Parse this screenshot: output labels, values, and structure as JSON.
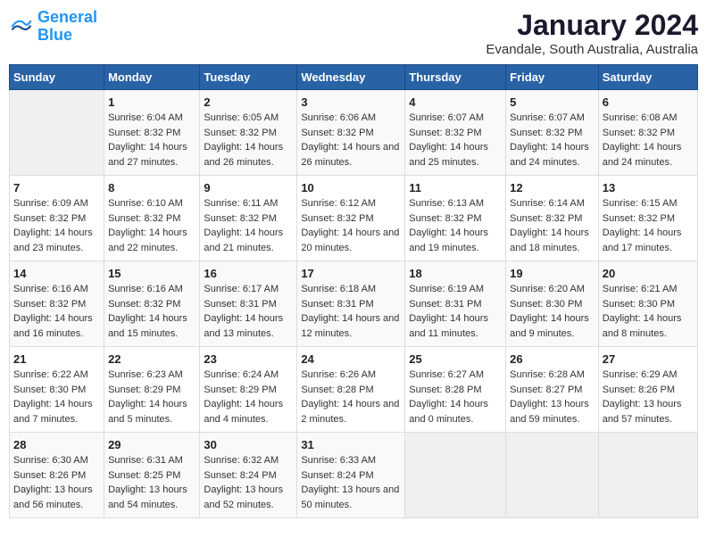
{
  "header": {
    "logo_line1": "General",
    "logo_line2": "Blue",
    "month": "January 2024",
    "location": "Evandale, South Australia, Australia"
  },
  "weekdays": [
    "Sunday",
    "Monday",
    "Tuesday",
    "Wednesday",
    "Thursday",
    "Friday",
    "Saturday"
  ],
  "weeks": [
    [
      {
        "day": "",
        "sunrise": "",
        "sunset": "",
        "daylight": ""
      },
      {
        "day": "1",
        "sunrise": "Sunrise: 6:04 AM",
        "sunset": "Sunset: 8:32 PM",
        "daylight": "Daylight: 14 hours and 27 minutes."
      },
      {
        "day": "2",
        "sunrise": "Sunrise: 6:05 AM",
        "sunset": "Sunset: 8:32 PM",
        "daylight": "Daylight: 14 hours and 26 minutes."
      },
      {
        "day": "3",
        "sunrise": "Sunrise: 6:06 AM",
        "sunset": "Sunset: 8:32 PM",
        "daylight": "Daylight: 14 hours and 26 minutes."
      },
      {
        "day": "4",
        "sunrise": "Sunrise: 6:07 AM",
        "sunset": "Sunset: 8:32 PM",
        "daylight": "Daylight: 14 hours and 25 minutes."
      },
      {
        "day": "5",
        "sunrise": "Sunrise: 6:07 AM",
        "sunset": "Sunset: 8:32 PM",
        "daylight": "Daylight: 14 hours and 24 minutes."
      },
      {
        "day": "6",
        "sunrise": "Sunrise: 6:08 AM",
        "sunset": "Sunset: 8:32 PM",
        "daylight": "Daylight: 14 hours and 24 minutes."
      }
    ],
    [
      {
        "day": "7",
        "sunrise": "Sunrise: 6:09 AM",
        "sunset": "Sunset: 8:32 PM",
        "daylight": "Daylight: 14 hours and 23 minutes."
      },
      {
        "day": "8",
        "sunrise": "Sunrise: 6:10 AM",
        "sunset": "Sunset: 8:32 PM",
        "daylight": "Daylight: 14 hours and 22 minutes."
      },
      {
        "day": "9",
        "sunrise": "Sunrise: 6:11 AM",
        "sunset": "Sunset: 8:32 PM",
        "daylight": "Daylight: 14 hours and 21 minutes."
      },
      {
        "day": "10",
        "sunrise": "Sunrise: 6:12 AM",
        "sunset": "Sunset: 8:32 PM",
        "daylight": "Daylight: 14 hours and 20 minutes."
      },
      {
        "day": "11",
        "sunrise": "Sunrise: 6:13 AM",
        "sunset": "Sunset: 8:32 PM",
        "daylight": "Daylight: 14 hours and 19 minutes."
      },
      {
        "day": "12",
        "sunrise": "Sunrise: 6:14 AM",
        "sunset": "Sunset: 8:32 PM",
        "daylight": "Daylight: 14 hours and 18 minutes."
      },
      {
        "day": "13",
        "sunrise": "Sunrise: 6:15 AM",
        "sunset": "Sunset: 8:32 PM",
        "daylight": "Daylight: 14 hours and 17 minutes."
      }
    ],
    [
      {
        "day": "14",
        "sunrise": "Sunrise: 6:16 AM",
        "sunset": "Sunset: 8:32 PM",
        "daylight": "Daylight: 14 hours and 16 minutes."
      },
      {
        "day": "15",
        "sunrise": "Sunrise: 6:16 AM",
        "sunset": "Sunset: 8:32 PM",
        "daylight": "Daylight: 14 hours and 15 minutes."
      },
      {
        "day": "16",
        "sunrise": "Sunrise: 6:17 AM",
        "sunset": "Sunset: 8:31 PM",
        "daylight": "Daylight: 14 hours and 13 minutes."
      },
      {
        "day": "17",
        "sunrise": "Sunrise: 6:18 AM",
        "sunset": "Sunset: 8:31 PM",
        "daylight": "Daylight: 14 hours and 12 minutes."
      },
      {
        "day": "18",
        "sunrise": "Sunrise: 6:19 AM",
        "sunset": "Sunset: 8:31 PM",
        "daylight": "Daylight: 14 hours and 11 minutes."
      },
      {
        "day": "19",
        "sunrise": "Sunrise: 6:20 AM",
        "sunset": "Sunset: 8:30 PM",
        "daylight": "Daylight: 14 hours and 9 minutes."
      },
      {
        "day": "20",
        "sunrise": "Sunrise: 6:21 AM",
        "sunset": "Sunset: 8:30 PM",
        "daylight": "Daylight: 14 hours and 8 minutes."
      }
    ],
    [
      {
        "day": "21",
        "sunrise": "Sunrise: 6:22 AM",
        "sunset": "Sunset: 8:30 PM",
        "daylight": "Daylight: 14 hours and 7 minutes."
      },
      {
        "day": "22",
        "sunrise": "Sunrise: 6:23 AM",
        "sunset": "Sunset: 8:29 PM",
        "daylight": "Daylight: 14 hours and 5 minutes."
      },
      {
        "day": "23",
        "sunrise": "Sunrise: 6:24 AM",
        "sunset": "Sunset: 8:29 PM",
        "daylight": "Daylight: 14 hours and 4 minutes."
      },
      {
        "day": "24",
        "sunrise": "Sunrise: 6:26 AM",
        "sunset": "Sunset: 8:28 PM",
        "daylight": "Daylight: 14 hours and 2 minutes."
      },
      {
        "day": "25",
        "sunrise": "Sunrise: 6:27 AM",
        "sunset": "Sunset: 8:28 PM",
        "daylight": "Daylight: 14 hours and 0 minutes."
      },
      {
        "day": "26",
        "sunrise": "Sunrise: 6:28 AM",
        "sunset": "Sunset: 8:27 PM",
        "daylight": "Daylight: 13 hours and 59 minutes."
      },
      {
        "day": "27",
        "sunrise": "Sunrise: 6:29 AM",
        "sunset": "Sunset: 8:26 PM",
        "daylight": "Daylight: 13 hours and 57 minutes."
      }
    ],
    [
      {
        "day": "28",
        "sunrise": "Sunrise: 6:30 AM",
        "sunset": "Sunset: 8:26 PM",
        "daylight": "Daylight: 13 hours and 56 minutes."
      },
      {
        "day": "29",
        "sunrise": "Sunrise: 6:31 AM",
        "sunset": "Sunset: 8:25 PM",
        "daylight": "Daylight: 13 hours and 54 minutes."
      },
      {
        "day": "30",
        "sunrise": "Sunrise: 6:32 AM",
        "sunset": "Sunset: 8:24 PM",
        "daylight": "Daylight: 13 hours and 52 minutes."
      },
      {
        "day": "31",
        "sunrise": "Sunrise: 6:33 AM",
        "sunset": "Sunset: 8:24 PM",
        "daylight": "Daylight: 13 hours and 50 minutes."
      },
      {
        "day": "",
        "sunrise": "",
        "sunset": "",
        "daylight": ""
      },
      {
        "day": "",
        "sunrise": "",
        "sunset": "",
        "daylight": ""
      },
      {
        "day": "",
        "sunrise": "",
        "sunset": "",
        "daylight": ""
      }
    ]
  ]
}
